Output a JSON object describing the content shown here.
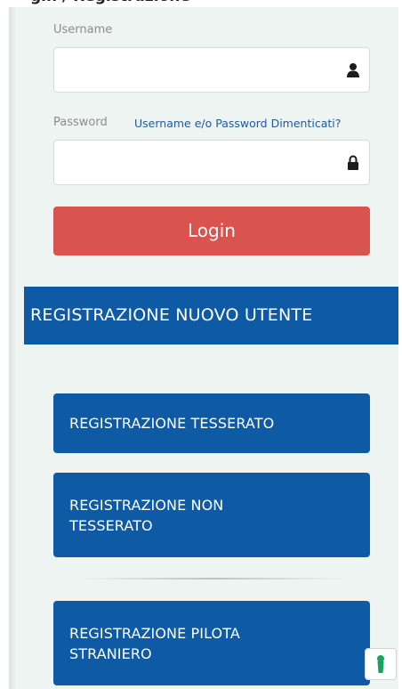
{
  "page": {
    "heading_partial": "gin / Registrazione"
  },
  "login": {
    "username_label": "Username",
    "username_value": "",
    "username_placeholder": "",
    "password_label": "Password",
    "password_value": "",
    "password_placeholder": "",
    "forgot_link": "Username e/o Password Dimenticati?",
    "login_button": "Login"
  },
  "registration": {
    "banner": "REGISTRAZIONE NUOVO UTENTE",
    "buttons": [
      "REGISTRAZIONE TESSERATO",
      "REGISTRAZIONE NON TESSERATO",
      "REGISTRAZIONE PILOTA STRANIERO"
    ]
  },
  "icons": {
    "username_icon": "user-icon",
    "password_icon": "lock-icon",
    "help_icon": "keyhole-icon"
  },
  "colors": {
    "background": "#eef4f2",
    "login_button": "#d9534f",
    "primary_blue": "#0e5aa5",
    "link": "#205a9c",
    "help_icon": "#1aa35c"
  }
}
